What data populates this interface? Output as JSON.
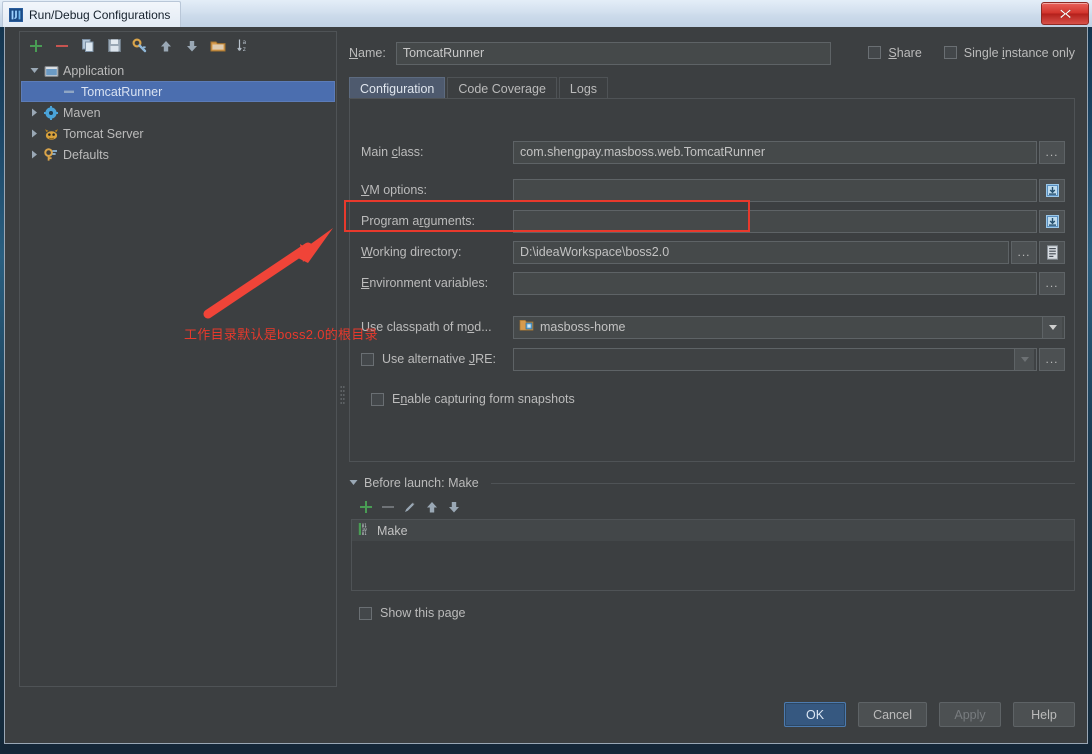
{
  "window": {
    "title": "Run/Debug Configurations",
    "app_icon": "idea-icon",
    "close_label": "×"
  },
  "left_panel": {
    "toolbar": [
      {
        "name": "add-configuration-button",
        "icon": "plus-icon",
        "label": "+"
      },
      {
        "name": "remove-configuration-button",
        "icon": "minus-icon",
        "label": "-"
      },
      {
        "name": "copy-configuration-button",
        "icon": "copy-icon",
        "label": "Copy"
      },
      {
        "name": "save-configuration-button",
        "icon": "save-icon",
        "label": "Save"
      },
      {
        "name": "edit-defaults-button",
        "icon": "wrench-icon",
        "label": "Edit defaults"
      },
      {
        "name": "move-up-button",
        "icon": "arrow-up-icon",
        "label": "Move Up"
      },
      {
        "name": "move-down-button",
        "icon": "arrow-down-icon",
        "label": "Move Down"
      },
      {
        "name": "create-folder-button",
        "icon": "folder-icon",
        "label": "Create new folder"
      },
      {
        "name": "sort-configurations-button",
        "icon": "sort-az-icon",
        "label": "Sort configurations"
      }
    ],
    "tree": [
      {
        "label": "Application",
        "icon": "application-icon",
        "expanded": true,
        "level": 0,
        "selected": false
      },
      {
        "label": "TomcatRunner",
        "icon": "run-config-icon",
        "expanded": null,
        "level": 1,
        "selected": true
      },
      {
        "label": "Maven",
        "icon": "maven-icon",
        "expanded": false,
        "level": 0,
        "selected": false
      },
      {
        "label": "Tomcat Server",
        "icon": "tomcat-icon",
        "expanded": false,
        "level": 0,
        "selected": false
      },
      {
        "label": "Defaults",
        "icon": "defaults-icon",
        "expanded": false,
        "level": 0,
        "selected": false
      }
    ]
  },
  "right_panel": {
    "name_label": "Name:",
    "name_value": "TomcatRunner",
    "share_label": "Share",
    "share_checked": false,
    "single_instance_label": "Single instance only",
    "single_instance_checked": false,
    "tabs": [
      {
        "label": "Configuration",
        "active": true
      },
      {
        "label": "Code Coverage",
        "active": false
      },
      {
        "label": "Logs",
        "active": false
      }
    ],
    "fields": {
      "main_class_label": "Main class:",
      "main_class_value": "com.shengpay.masboss.web.TomcatRunner",
      "vm_options_label": "VM options:",
      "vm_options_value": "",
      "program_arguments_label": "Program arguments:",
      "program_arguments_value": "",
      "working_directory_label": "Working directory:",
      "working_directory_value": "D:\\ideaWorkspace\\boss2.0",
      "environment_variables_label": "Environment variables:",
      "environment_variables_value": "",
      "use_classpath_label": "Use classpath of mod...",
      "use_classpath_value": "masboss-home",
      "use_classpath_icon": "module-icon",
      "use_alternative_jre_label": "Use alternative JRE:",
      "use_alternative_jre_checked": false,
      "use_alternative_jre_value": "",
      "enable_snapshots_label": "Enable capturing form snapshots",
      "enable_snapshots_checked": false
    },
    "browse_label": "...",
    "before_launch": {
      "header": "Before launch: Make",
      "toolbar": [
        {
          "name": "before-launch-add-button",
          "icon": "plus-icon",
          "label": "+"
        },
        {
          "name": "before-launch-remove-button",
          "icon": "minus-icon",
          "label": "-"
        },
        {
          "name": "before-launch-edit-button",
          "icon": "pencil-icon",
          "label": "Edit"
        },
        {
          "name": "before-launch-move-up-button",
          "icon": "arrow-up-icon",
          "label": "Move up"
        },
        {
          "name": "before-launch-move-down-button",
          "icon": "arrow-down-icon",
          "label": "Move down"
        }
      ],
      "items": [
        {
          "label": "Make",
          "icon": "make-icon"
        }
      ]
    },
    "show_this_page_label": "Show this page",
    "show_this_page_checked": false
  },
  "buttons": {
    "ok": "OK",
    "cancel": "Cancel",
    "apply": "Apply",
    "help": "Help"
  },
  "annotation": {
    "text": "工作目录默认是boss2.0的根目录",
    "color": "#e8392c"
  },
  "colors": {
    "accent_selection": "#4b6eaf",
    "primary_button": "#365880",
    "panel_bg": "#3c3f41",
    "input_bg": "#45494a",
    "annotation_red": "#e8392c"
  }
}
